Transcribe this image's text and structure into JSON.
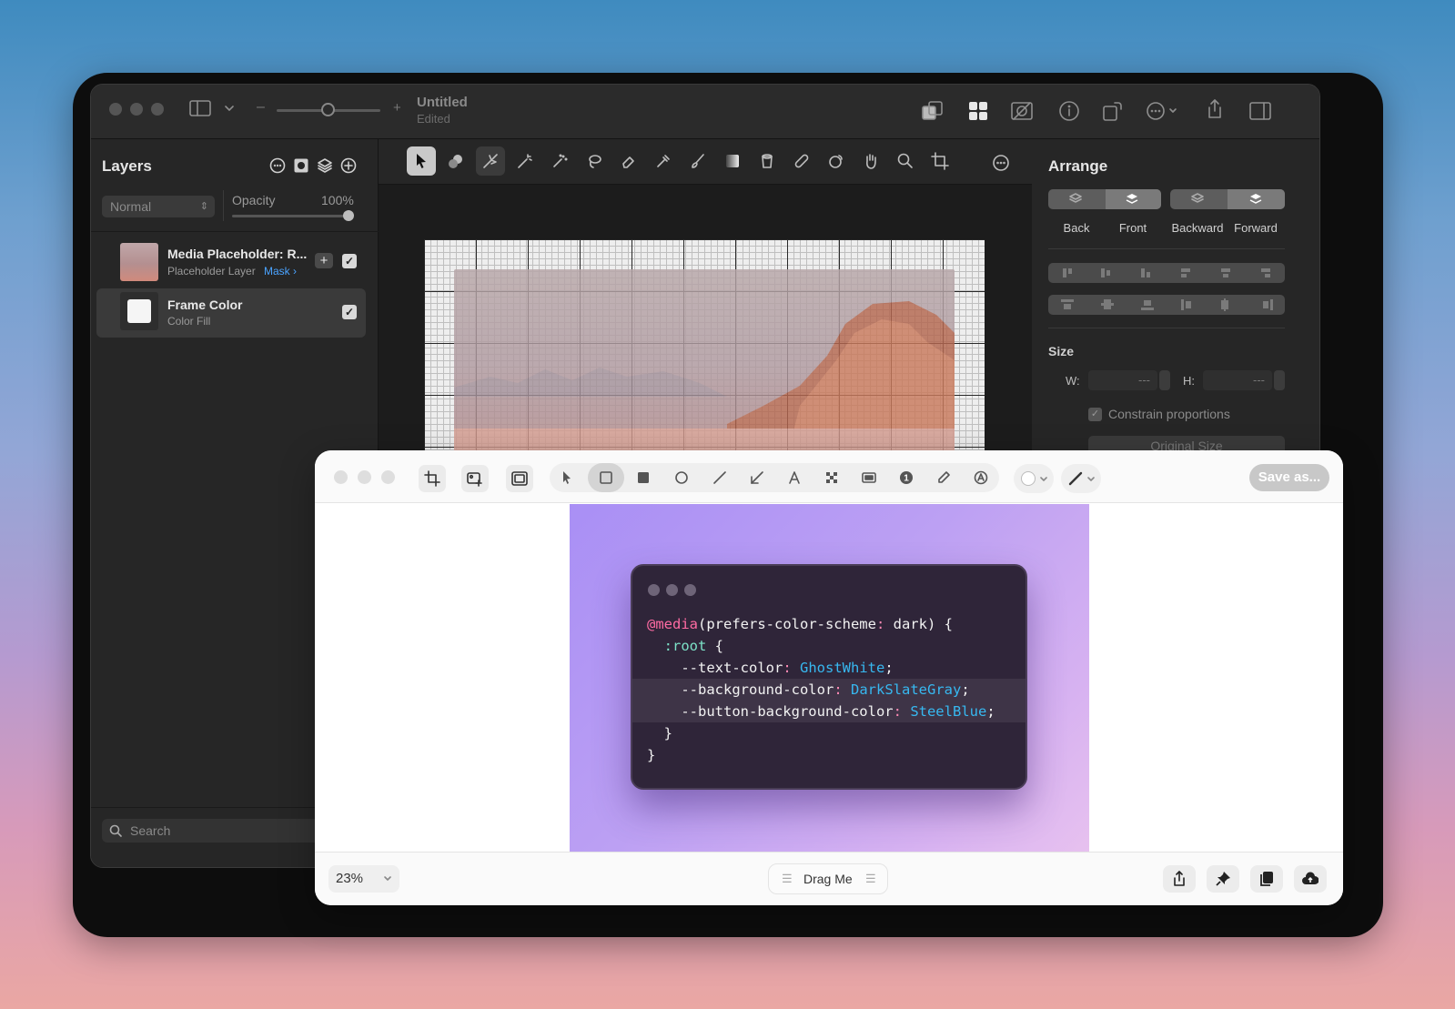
{
  "app": {
    "title": "Untitled",
    "subtitle": "Edited"
  },
  "layers_panel": {
    "title": "Layers",
    "blend_mode": "Normal",
    "opacity_label": "Opacity",
    "opacity_value": "100%",
    "items": [
      {
        "name": "Media Placeholder: R...",
        "sub": "Placeholder Layer",
        "link": "Mask ›"
      },
      {
        "name": "Frame Color",
        "sub": "Color Fill"
      }
    ],
    "search_placeholder": "Search"
  },
  "arrange": {
    "title": "Arrange",
    "order_buttons": [
      "Back",
      "Front",
      "Backward",
      "Forward"
    ],
    "size_title": "Size",
    "w_label": "W:",
    "h_label": "H:",
    "w_value": "---",
    "h_value": "---",
    "constrain": "Constrain proportions",
    "original_size": "Original Size"
  },
  "screenshot_window": {
    "save_label": "Save as...",
    "zoom": "23%",
    "drag_label": "Drag Me",
    "code_lines": [
      {
        "parts": [
          [
            "k1",
            "@media"
          ],
          [
            "",
            "(prefers-color-scheme"
          ],
          [
            "k4",
            ":"
          ],
          [
            "",
            " dark) {"
          ]
        ]
      },
      {
        "parts": [
          [
            "",
            "  "
          ],
          [
            "k2",
            ":root"
          ],
          [
            "",
            " {"
          ]
        ]
      },
      {
        "parts": [
          [
            "",
            "    --text-color"
          ],
          [
            "k4",
            ":"
          ],
          [
            "",
            " "
          ],
          [
            "k3",
            "GhostWhite"
          ],
          [
            "",
            ";"
          ]
        ]
      },
      {
        "parts": [
          [
            "",
            "    --background-color"
          ],
          [
            "k4",
            ":"
          ],
          [
            "",
            " "
          ],
          [
            "k3",
            "DarkSlateGray"
          ],
          [
            "",
            ";"
          ]
        ]
      },
      {
        "parts": [
          [
            "",
            "    --button-background-color"
          ],
          [
            "k4",
            ":"
          ],
          [
            "",
            " "
          ],
          [
            "k3",
            "SteelBlue"
          ],
          [
            "",
            ";"
          ]
        ]
      },
      {
        "parts": [
          [
            "",
            "  }"
          ]
        ]
      },
      {
        "parts": [
          [
            "",
            "}"
          ]
        ]
      }
    ]
  },
  "colors": {
    "accent_blue": "#4aa3ff",
    "code_bg": "#2f2539",
    "keyword_pink": "#ff6ba3",
    "selector_teal": "#7de2c8",
    "value_blue": "#37b8f0"
  }
}
